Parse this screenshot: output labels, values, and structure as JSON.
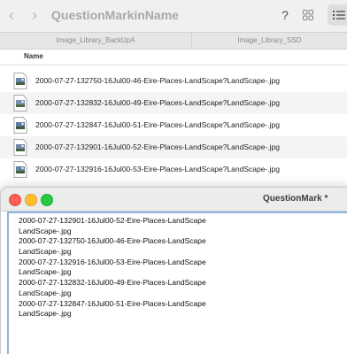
{
  "finder": {
    "title": "QuestionMarkinName",
    "back_icon": "chevron-left-icon",
    "forward_icon": "chevron-right-icon",
    "help_label": "?",
    "path_tabs": [
      "Image_Library_BackUpA",
      "Image_Library_SSD"
    ],
    "column_name": "Name",
    "files": [
      "2000-07-27-132750-16Jul00-46-Eire-Places-LandScape?LandScape-.jpg",
      "2000-07-27-132832-16Jul00-49-Eire-Places-LandScape?LandScape-.jpg",
      "2000-07-27-132847-16Jul00-51-Eire-Places-LandScape?LandScape-.jpg",
      "2000-07-27-132901-16Jul00-52-Eire-Places-LandScape?LandScape-.jpg",
      "2000-07-27-132916-16Jul00-53-Eire-Places-LandScape?LandScape-.jpg"
    ]
  },
  "textedit": {
    "title": "QuestionMark *",
    "lines": [
      "2000-07-27-132901-16Jul00-52-Eire-Places-LandScape",
      "LandScape-.jpg",
      "2000-07-27-132750-16Jul00-46-Eire-Places-LandScape",
      "LandScape-.jpg",
      "2000-07-27-132916-16Jul00-53-Eire-Places-LandScape",
      "LandScape-.jpg",
      "2000-07-27-132832-16Jul00-49-Eire-Places-LandScape",
      "LandScape-.jpg",
      "2000-07-27-132847-16Jul00-51-Eire-Places-LandScape",
      "LandScape-.jpg"
    ]
  },
  "colors": {
    "close": "#fd5f57",
    "minimize": "#febc2e",
    "maximize": "#28c840",
    "selection_border": "#8cb4e0"
  }
}
